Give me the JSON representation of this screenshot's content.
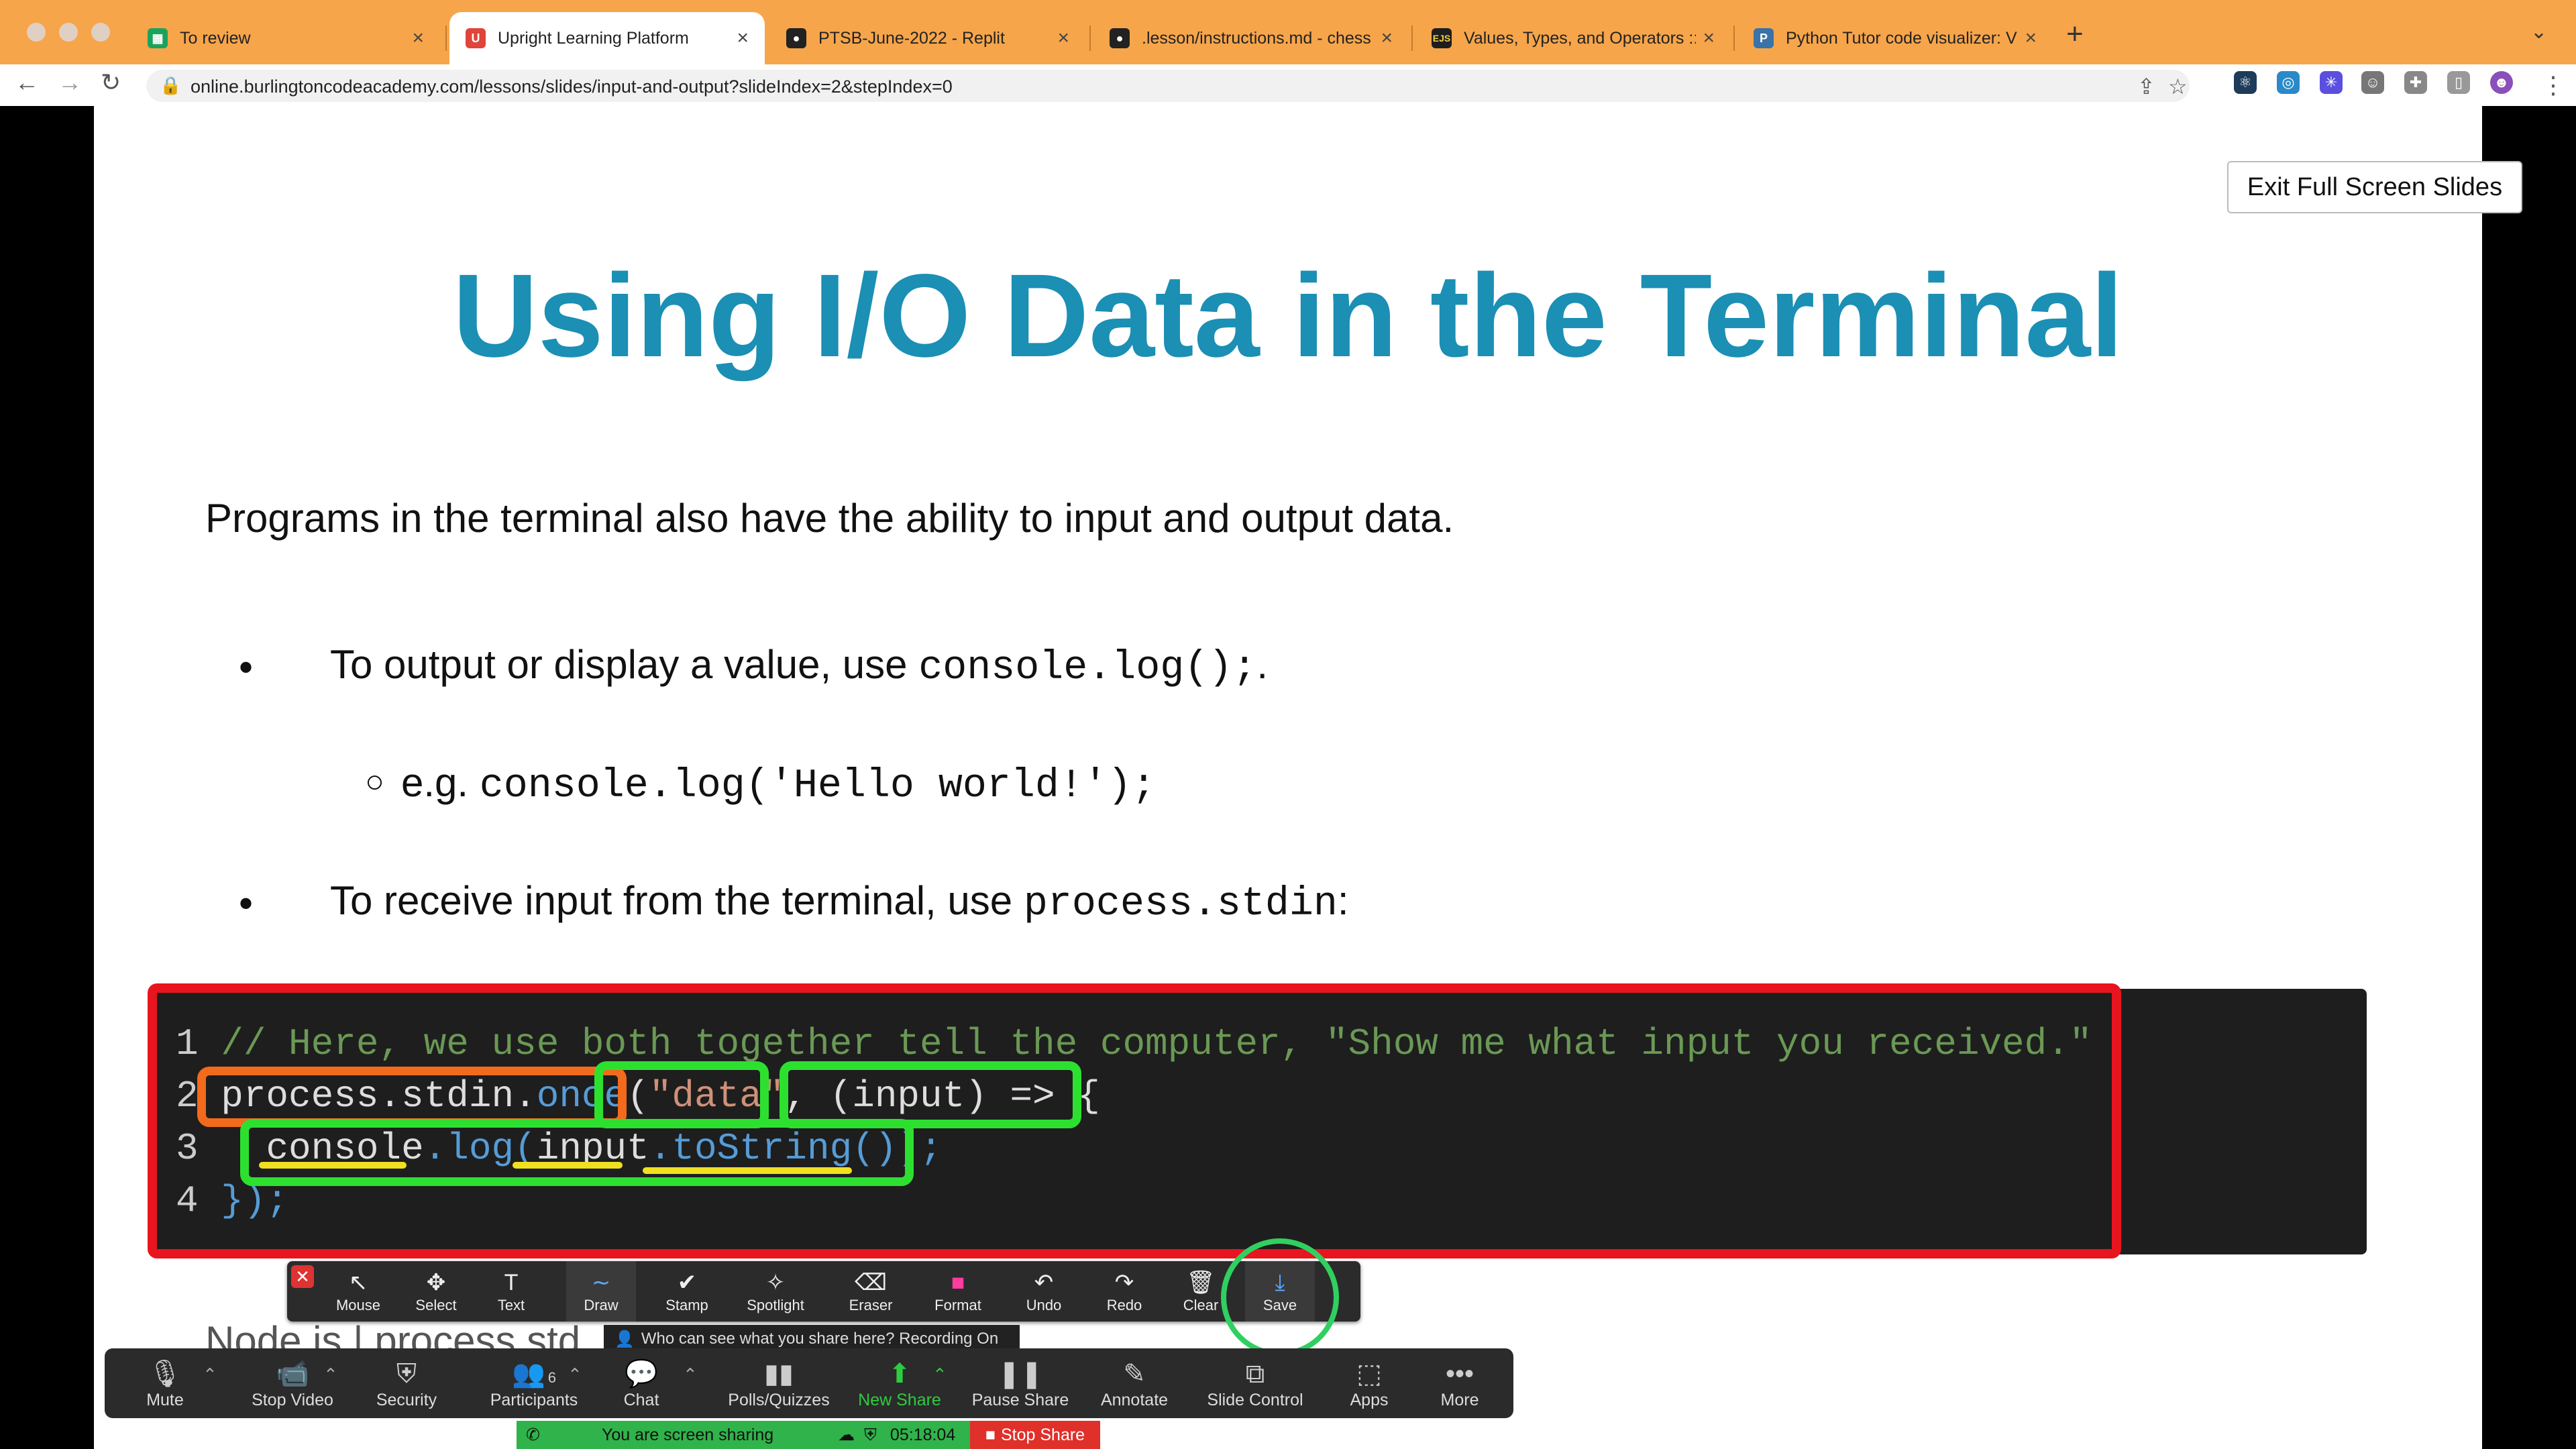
{
  "browser": {
    "tabs": [
      {
        "label": "To review",
        "icon": "sheets-icon",
        "color": "#1aa35b",
        "glyph": "▦"
      },
      {
        "label": "Upright Learning Platform",
        "icon": "upright-icon",
        "color": "#e0443a",
        "glyph": "U",
        "active": true
      },
      {
        "label": "PTSB-June-2022 - Replit",
        "icon": "github-icon",
        "color": "#222222",
        "glyph": "●"
      },
      {
        "label": ".lesson/instructions.md - chess",
        "icon": "github-icon",
        "color": "#222222",
        "glyph": "●"
      },
      {
        "label": "Values, Types, and Operators ::",
        "icon": "ejs-icon",
        "color": "#1d1d1d",
        "glyph": "EJS"
      },
      {
        "label": "Python Tutor code visualizer: V",
        "icon": "python-icon",
        "color": "#3a73a8",
        "glyph": "P"
      }
    ],
    "url": "online.burlingtoncodeacademy.com/lessons/slides/input-and-output?slideIndex=2&stepIndex=0"
  },
  "slide": {
    "exit_button": "Exit Full Screen Slides",
    "title": "Using I/O Data in the Terminal",
    "intro": "Programs in the terminal also have the ability to input and output data.",
    "bullet1_text": "To output or display a value, use ",
    "bullet1_code": "console.log();",
    "bullet1_end": ".",
    "sub_bullet_prefix": "e.g. ",
    "sub_bullet_code": "console.log('Hello world!');",
    "bullet2_text": "To receive input from the terminal, use ",
    "bullet2_code": "process.stdin",
    "bullet2_end": ":",
    "code": {
      "line_numbers": [
        "1",
        "2",
        "3",
        "4"
      ],
      "line1": "// Here, we use both together tell the computer, \"Show me what input you received.\"",
      "line2_a": "process",
      "line2_b": ".",
      "line2_c": "stdin",
      "line2_d": ".",
      "line2_e": "once",
      "line2_f": "(",
      "line2_g": "\"data\"",
      "line2_h": ", ",
      "line2_i": "(input) => {",
      "line3_a": "console",
      "line3_b": ".log(",
      "line3_c": "input",
      "line3_d": ".",
      "line3_e": "toString",
      "line3_f": "());",
      "line4": "});"
    },
    "footer_text": "Node.js | process.std"
  },
  "annotation_toolbar": {
    "buttons": [
      {
        "label": "Mouse",
        "icon": "cursor-arrow-icon",
        "glyph": "↖"
      },
      {
        "label": "Select",
        "icon": "move-icon",
        "glyph": "✥"
      },
      {
        "label": "Text",
        "icon": "text-icon",
        "glyph": "T"
      },
      {
        "label": "Draw",
        "icon": "draw-squiggle-icon",
        "glyph": "∼"
      },
      {
        "label": "Stamp",
        "icon": "checkmark-icon",
        "glyph": "✔"
      },
      {
        "label": "Spotlight",
        "icon": "wand-icon",
        "glyph": "✧"
      },
      {
        "label": "Eraser",
        "icon": "eraser-icon",
        "glyph": "⌫"
      },
      {
        "label": "Format",
        "icon": "format-icon",
        "glyph": "■",
        "color": "#ff3ca0"
      },
      {
        "label": "Undo",
        "icon": "undo-icon",
        "glyph": "↶"
      },
      {
        "label": "Redo",
        "icon": "redo-icon",
        "glyph": "↷"
      },
      {
        "label": "Clear",
        "icon": "trash-icon",
        "glyph": "🗑"
      },
      {
        "label": "Save",
        "icon": "save-icon",
        "glyph": "⤓"
      }
    ],
    "who_can_see": "Who can see what you share here? Recording On"
  },
  "zoom_toolbar": {
    "buttons": [
      {
        "label": "Mute",
        "icon": "microphone-icon",
        "glyph": "🎙"
      },
      {
        "label": "Stop Video",
        "icon": "video-camera-icon",
        "glyph": "📹"
      },
      {
        "label": "Security",
        "icon": "shield-icon",
        "glyph": "⛨"
      },
      {
        "label": "Participants",
        "icon": "participants-icon",
        "glyph": "👥",
        "count": "6"
      },
      {
        "label": "Chat",
        "icon": "chat-icon",
        "glyph": "💬"
      },
      {
        "label": "Polls/Quizzes",
        "icon": "poll-icon",
        "glyph": "▮▮"
      },
      {
        "label": "New Share",
        "icon": "share-up-icon",
        "glyph": "⬆"
      },
      {
        "label": "Pause Share",
        "icon": "pause-icon",
        "glyph": "❚❚"
      },
      {
        "label": "Annotate",
        "icon": "pencil-icon",
        "glyph": "✎"
      },
      {
        "label": "Slide Control",
        "icon": "slide-control-icon",
        "glyph": "⧉"
      },
      {
        "label": "Apps",
        "icon": "apps-icon",
        "glyph": "⬚"
      },
      {
        "label": "More",
        "icon": "more-icon",
        "glyph": "•••"
      }
    ],
    "sharing_text": "You are screen sharing",
    "timer": "05:18:04",
    "stop_share": "Stop Share"
  }
}
